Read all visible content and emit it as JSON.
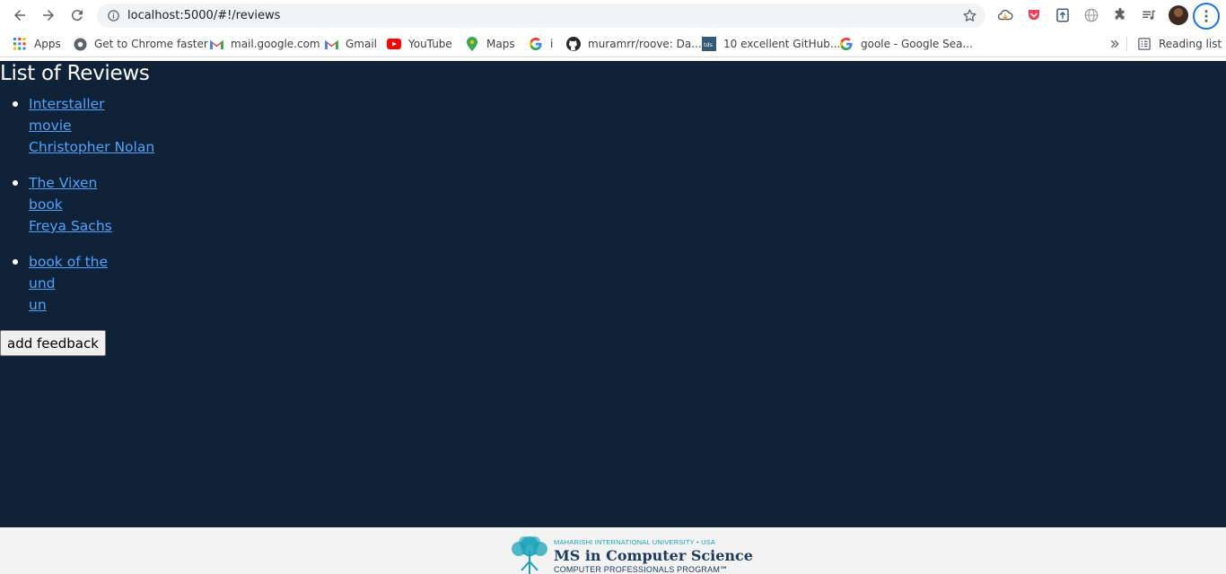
{
  "browser": {
    "url": "localhost:5000/#!/reviews",
    "bookmarks": [
      {
        "label": "Apps",
        "icon": "apps-grid-icon"
      },
      {
        "label": "Get to Chrome faster",
        "icon": "chrome-icon"
      },
      {
        "label": "mail.google.com",
        "icon": "gmail-icon"
      },
      {
        "label": "Gmail",
        "icon": "gmail-icon"
      },
      {
        "label": "YouTube",
        "icon": "youtube-icon"
      },
      {
        "label": "Maps",
        "icon": "maps-pin-icon"
      },
      {
        "label": "i",
        "icon": "google-icon"
      },
      {
        "label": "muramrr/roove: Da...",
        "icon": "github-icon"
      },
      {
        "label": "10 excellent GitHub...",
        "icon": "tds-icon"
      },
      {
        "label": "goole - Google Sea...",
        "icon": "google-icon"
      }
    ],
    "reading_list": "Reading list"
  },
  "page": {
    "title": "List of Reviews",
    "reviews": [
      {
        "title": "Interstaller",
        "type": "movie",
        "author": "Christopher Nolan"
      },
      {
        "title": "The Vixen",
        "type": "book",
        "author": "Freya Sachs"
      },
      {
        "title": "book of the",
        "type": "und",
        "author": "un"
      }
    ],
    "add_button": "add feedback"
  },
  "footer": {
    "university": "MAHARISHI INTERNATIONAL UNIVERSITY • USA",
    "program": "MS in Computer Science",
    "subtitle": "COMPUTER PROFESSIONALS PROGRAM℠"
  },
  "colors": {
    "page_bg": "#0f2237",
    "link": "#4fa3ff",
    "footer_bg": "#f3f3f3",
    "logo_teal": "#1aa3b8",
    "logo_navy": "#1b3a5c"
  }
}
